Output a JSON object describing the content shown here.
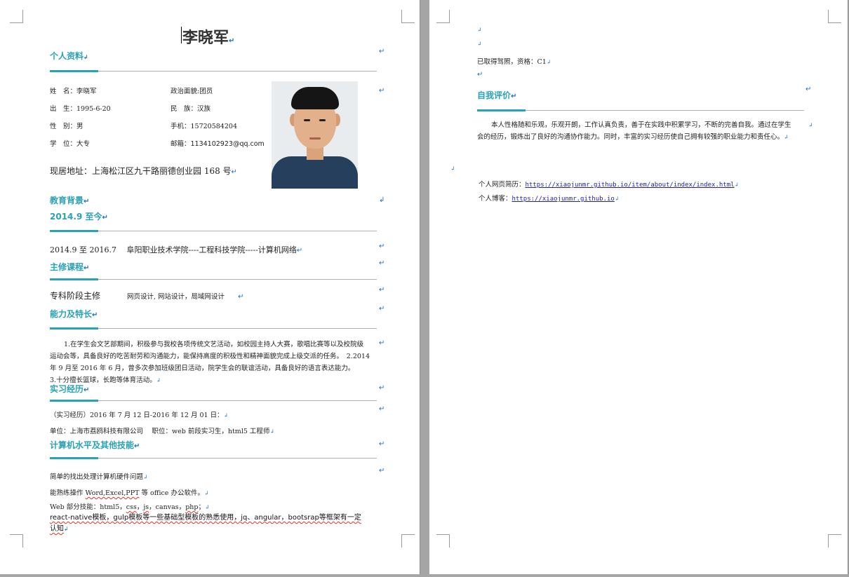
{
  "resume": {
    "name": "李晓军",
    "sections": {
      "personal": "个人资料",
      "education": "教育背景",
      "education_period": "2014.9 至今",
      "courses": "主修课程",
      "skills": "能力及特长",
      "internship": "实习经历",
      "computer": "计算机水平及其他技能",
      "self_eval": "自我评价"
    },
    "personal": {
      "name_row": "姓　名：李晓军",
      "political": "政治面貌:团员",
      "birth": "出　生：1995-6-20",
      "ethnicity": "民　族：汉族",
      "gender": "性　别：男",
      "phone": "手机：15720584204",
      "degree": "学　位：大专",
      "email": "邮箱：1134102923@qq.com",
      "address": "现居地址：上海松江区九干路丽德创业园 168 号"
    },
    "education": {
      "line": "2014.9 至 2016.7　  阜阳职业技术学院----工程科技学院-----计算机网络"
    },
    "courses": {
      "label": "专科阶段主修",
      "list": "网页设计, 网站设计，局域网设计"
    },
    "skills": {
      "paragraph": "1.在学生会文艺部期间，积极参与我校各项传统文艺活动，如校园主持人大赛，歌唱比赛等以及校院级运动会等，具备良好的吃苦耐劳和沟通能力，能保持高度的积极性和精神面貌完成上级交派的任务。　2.2014 年 9 月至 2016 年 6 月，曾多次参加班级团日活动，院学生会的联谊活动，具备良好的语言表达能力。　　3.十分擅长篮球，长跑等体育活动。"
    },
    "internship": {
      "period": "（实习经历）2016 年 7 月 12 日-2016 年 12 月 01 日：",
      "company": "单位：上海市荔鸥科技有限公司　 职位：web 前段实习生，html5 工程师"
    },
    "computer": {
      "line1": "简单的找出处理计算机硬件问题",
      "line2_pre": "能熟练操作 ",
      "line2_mark": "Word,Excel,PPT",
      "line2_post": " 等 office 办公软件。",
      "line3_pre": "Web 部分技能：html5，",
      "line3_css": "css",
      "line3_mid": "，",
      "line3_js": "js",
      "line3_mid2": "，canvas，",
      "line3_php": "php",
      "line3_end": "；",
      "line4": "react-native模板，gulp模板等一些基础型模板的熟悉使用，jq、angular，bootsrap等框架有一定",
      "line5": "认知"
    },
    "page2": {
      "license": "已取得驾照，资格：C1",
      "self_eval": "本人性格随和乐观，乐观开朗，工作认真负责，善于在实践中积累学习，不断的完善自我。通过在学生会的经历，锻炼出了良好的沟通协作能力。同时，丰富的实习经历使自己拥有较强的职业能力和责任心。",
      "homepage_label": "个人网页简历：",
      "homepage_url": "https://xiaojunmr.github.io/item/about/index/index.html",
      "blog_label": "个人博客：",
      "blog_url": "https://xiaojunmr.github.io"
    },
    "marks": {
      "para": "↵",
      "small": "↲"
    }
  }
}
